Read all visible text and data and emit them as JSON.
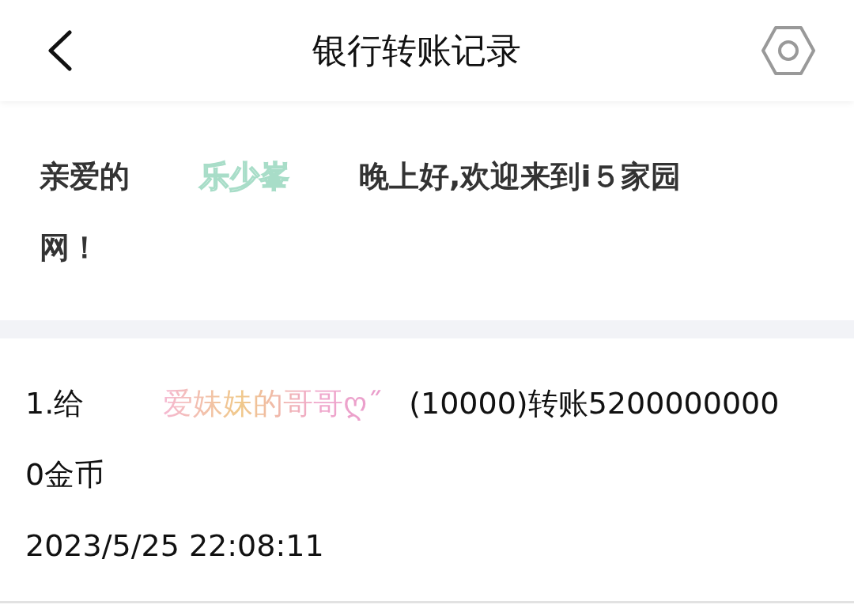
{
  "header": {
    "title": "银行转账记录"
  },
  "greeting": {
    "prefix": "亲爱的",
    "username": "乐少峯",
    "suffix": "晚上好,欢迎来到i５家园网！"
  },
  "records": [
    {
      "index": "1.给",
      "recipient": "爱妹妹的哥哥ღ˝",
      "detail": "(10000)转账52000000000金币",
      "time": "2023/5/25 22:08:11"
    }
  ]
}
